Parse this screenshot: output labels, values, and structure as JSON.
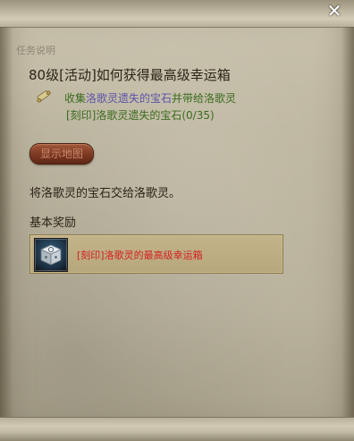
{
  "window": {
    "close_label": "✕"
  },
  "quest": {
    "section_label": "任务说明",
    "title": "80级[活动]如何获得最高级幸运箱",
    "objective": {
      "prefix": "收集",
      "item_highlight": "洛歌灵遗失的宝石",
      "suffix": "并带给洛歌灵",
      "progress_line": "[刻印]洛歌灵遗失的宝石(0/35)"
    },
    "show_map_label": "显示地图",
    "description": "将洛歌灵的宝石交给洛歌灵。"
  },
  "rewards": {
    "heading": "基本奖励",
    "items": [
      {
        "name": "[刻印]洛歌灵的最高级幸运箱",
        "icon": "lucky-box-icon"
      }
    ]
  },
  "colors": {
    "objective_text": "#3b6b1e",
    "objective_highlight": "#5b52a8",
    "reward_name": "#d61e1e",
    "body_text": "#2c2518"
  }
}
